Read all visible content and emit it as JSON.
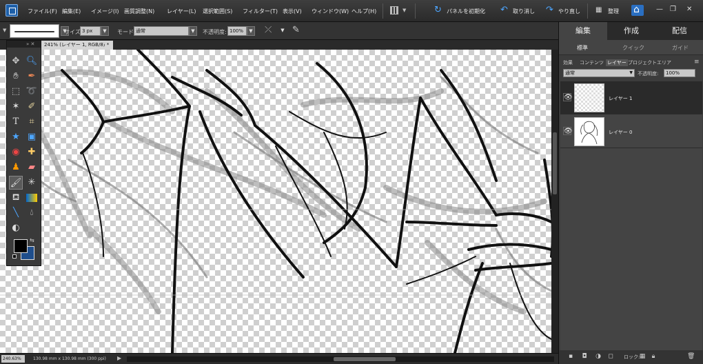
{
  "menubar": {
    "items": [
      "ファイル(F)",
      "編集(E)",
      "イメージ(I)",
      "画質調整(N)",
      "レイヤー(L)",
      "選択範囲(S)",
      "フィルター(T)",
      "表示(V)",
      "ウィンドウ(W)",
      "ヘルプ(H)"
    ],
    "reset_panels": "パネルを初期化",
    "undo": "取り消し",
    "redo": "やり直し",
    "organizer": "整理"
  },
  "options": {
    "size_label": "サイズ:",
    "size_value": "3 px",
    "mode_label": "モード:",
    "mode_value": "通常",
    "opacity_label": "不透明度:",
    "opacity_value": "100%"
  },
  "document": {
    "tab_title": "241% (レイヤー 1, RGB/8) *",
    "close": "×"
  },
  "status": {
    "zoom": "240.63%",
    "doc_size": "130.98 mm x 130.98 mm (300 ppi)"
  },
  "panel": {
    "tabs": [
      "編集",
      "作成",
      "配信"
    ],
    "subtabs": [
      "標準",
      "クイック",
      "ガイド"
    ],
    "layer_tabs": [
      "効果",
      "コンテンツ",
      "レイヤー",
      "プロジェクトエリア"
    ],
    "blend_mode": "通常",
    "opacity_label": "不透明度:",
    "opacity_value": "100%",
    "layers": [
      {
        "name": "レイヤー 1",
        "selected": true
      },
      {
        "name": "レイヤー 0",
        "selected": false
      }
    ],
    "lock_label": "ロック:"
  },
  "colors": {
    "foreground": "#000000",
    "background": "#1f4e8c",
    "accent": "#4da6ff"
  }
}
